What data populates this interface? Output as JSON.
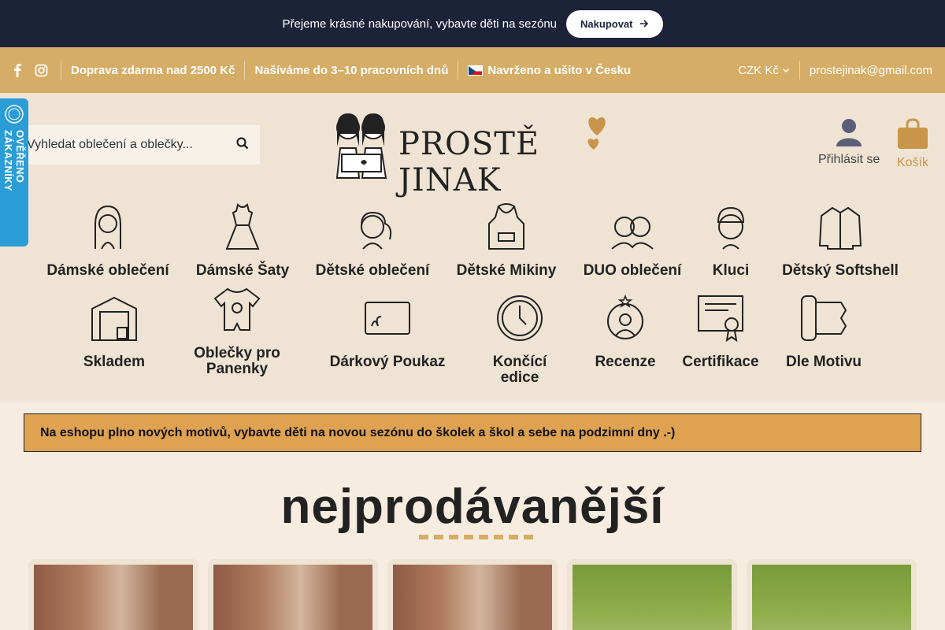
{
  "announcement": {
    "text": "Přejeme krásné nakupování, vybavte děti na sezónu",
    "button_label": "Nakupovat"
  },
  "infobar": {
    "items": [
      "Doprava zdarma nad 2500 Kč",
      "Našíváme do 3–10 pracovních dnů",
      "Navrženo a ušito v Česku"
    ],
    "currency": "CZK Kč",
    "email": "prostejinak@gmail.com"
  },
  "search": {
    "placeholder": "Vyhledat oblečení a oblečky..."
  },
  "logo": {
    "text": "PROSTĚ JINAK"
  },
  "account": {
    "login_label": "Přihlásit se",
    "cart_label": "Košík"
  },
  "categories_row1": [
    {
      "label": "Dámské oblečení",
      "icon": "woman-icon"
    },
    {
      "label": "Dámské Šaty",
      "icon": "dress-icon"
    },
    {
      "label": "Dětské oblečení",
      "icon": "girl-icon"
    },
    {
      "label": "Dětské Mikiny",
      "icon": "hoodie-icon"
    },
    {
      "label": "DUO oblečení",
      "icon": "duo-icon"
    },
    {
      "label": "Kluci",
      "icon": "boy-icon"
    },
    {
      "label": "Dětský Softshell",
      "icon": "jacket-icon"
    }
  ],
  "categories_row2": [
    {
      "label": "Skladem",
      "icon": "warehouse-icon"
    },
    {
      "label": "Oblečky pro Panenky",
      "icon": "baby-onesie-icon"
    },
    {
      "label": "Dárkový Poukaz",
      "icon": "gift-card-icon"
    },
    {
      "label": "Končící edice",
      "icon": "clock-icon"
    },
    {
      "label": "Recenze",
      "icon": "review-icon"
    },
    {
      "label": "Certifikace",
      "icon": "certificate-icon"
    },
    {
      "label": "Dle Motivu",
      "icon": "fabric-roll-icon"
    }
  ],
  "notice": {
    "text": "Na eshopu plno nových motivů, vybavte děti na novou sezónu do školek a škol a sebe na podzimní dny .-)"
  },
  "section": {
    "title": "nejprodávanější"
  },
  "badge": {
    "text": "OVĚŘENO ZÁKAZNÍKY"
  },
  "colors": {
    "navy": "#1c2238",
    "gold": "#d6ad66",
    "beige": "#efe4d4",
    "notice": "#dea251",
    "badge": "#2a9cd6"
  }
}
